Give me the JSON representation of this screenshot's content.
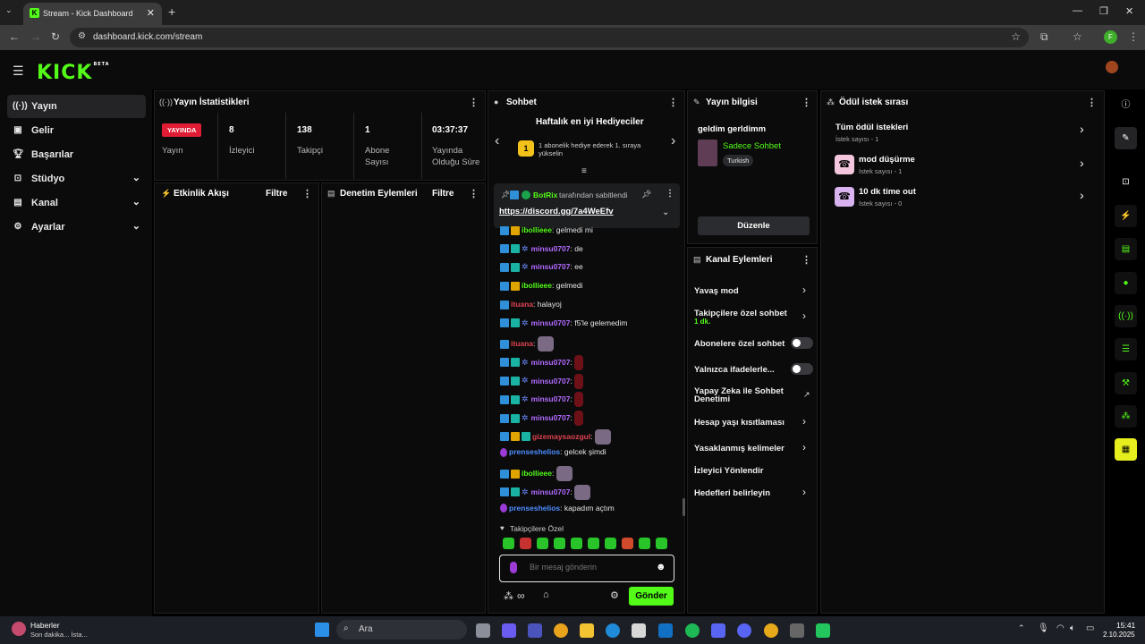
{
  "browser": {
    "tab_title": "Stream - Kick Dashboard",
    "favicon_letter": "K",
    "url": "dashboard.kick.com/stream",
    "profile_letter": "F"
  },
  "kick": {
    "logo": "KICK",
    "logo_badge": "BETA"
  },
  "sidebar": {
    "items": [
      {
        "label": "Yayın",
        "icon": "broadcast-icon"
      },
      {
        "label": "Gelir",
        "icon": "money-icon"
      },
      {
        "label": "Başarılar",
        "icon": "trophy-icon"
      },
      {
        "label": "Stüdyo",
        "icon": "studio-icon"
      },
      {
        "label": "Kanal",
        "icon": "channel-icon"
      },
      {
        "label": "Ayarlar",
        "icon": "gear-icon"
      }
    ]
  },
  "stats": {
    "title": "Yayın İstatistikleri",
    "live_badge": "YAYINDA",
    "live_label": "Yayın",
    "items": [
      {
        "value": "8",
        "label": "İzleyici"
      },
      {
        "value": "138",
        "label": "Takipçi"
      },
      {
        "value": "1",
        "label": "Abone Sayısı"
      },
      {
        "value": "03:37:37",
        "label": "Yayında Olduğu Süre"
      }
    ]
  },
  "activity": {
    "title": "Etkinlik Akışı",
    "filter": "Filtre"
  },
  "moderation": {
    "title": "Denetim Eylemleri",
    "filter": "Filtre"
  },
  "chat": {
    "title": "Sohbet",
    "gifters_title": "Haftalık en iyi Hediyeciler",
    "gifters_rank": "1",
    "gifters_text": "1 abonelik hediye ederek 1. sıraya yükselin",
    "pinned": {
      "user": "BotRix",
      "pinned_by": "tarafından sabitlendi",
      "link": "https://discord.gg/7a4WeEfv"
    },
    "messages": [
      {
        "user": "ibollieee",
        "color": "#53fc18",
        "text": "gelmedi mi",
        "badges": [
          "blue",
          "gold"
        ]
      },
      {
        "user": "minsu0707",
        "color": "#b26bff",
        "text": "de",
        "badges": [
          "blue",
          "teal",
          "gear"
        ]
      },
      {
        "user": "minsu0707",
        "color": "#b26bff",
        "text": "ee",
        "badges": [
          "blue",
          "teal",
          "gear"
        ]
      },
      {
        "user": "ibollieee",
        "color": "#53fc18",
        "text": "gelmedi",
        "badges": [
          "blue",
          "gold"
        ]
      },
      {
        "user": "ituana",
        "color": "#e0424f",
        "text": "halayoj",
        "badges": [
          "blue"
        ]
      },
      {
        "user": "minsu0707",
        "color": "#b26bff",
        "text": "f5'le gelemedim",
        "badges": [
          "blue",
          "teal",
          "gear"
        ]
      },
      {
        "user": "ituana",
        "color": "#e0424f",
        "text": "",
        "emote": "gray",
        "badges": [
          "blue"
        ]
      },
      {
        "user": "minsu0707",
        "color": "#b26bff",
        "text": "",
        "emote": "red",
        "badges": [
          "blue",
          "teal",
          "gear"
        ]
      },
      {
        "user": "minsu0707",
        "color": "#b26bff",
        "text": "",
        "emote": "red",
        "badges": [
          "blue",
          "teal",
          "gear"
        ]
      },
      {
        "user": "minsu0707",
        "color": "#b26bff",
        "text": "",
        "emote": "red",
        "badges": [
          "blue",
          "teal",
          "gear"
        ]
      },
      {
        "user": "minsu0707",
        "color": "#b26bff",
        "text": "",
        "emote": "red",
        "badges": [
          "blue",
          "teal",
          "gear"
        ]
      },
      {
        "user": "gizemaysaozgul",
        "color": "#e0424f",
        "text": "",
        "emote": "gray",
        "badges": [
          "blue",
          "gold",
          "teal"
        ]
      },
      {
        "user": "prenseshelios",
        "color": "#4d8dff",
        "text": "gelcek şimdi",
        "badges": [
          "mic"
        ]
      },
      {
        "user": "ibollieee",
        "color": "#53fc18",
        "text": "",
        "emote": "gray",
        "badges": [
          "blue",
          "gold"
        ]
      },
      {
        "user": "minsu0707",
        "color": "#b26bff",
        "text": "",
        "emote": "gray",
        "badges": [
          "blue",
          "teal",
          "gear"
        ]
      },
      {
        "user": "prenseshelios",
        "color": "#4d8dff",
        "text": "kapadım açtım",
        "badges": [
          "mic"
        ]
      }
    ],
    "followers_only_label": "Takipçilere Özel",
    "input_placeholder": "Bir mesaj gönderin",
    "send_label": "Gönder"
  },
  "stream_info": {
    "title": "Yayın bilgisi",
    "stream_title": "geldim gerldimm",
    "category": "Sadece Sohbet",
    "language": "Turkish",
    "edit_label": "Düzenle"
  },
  "channel_actions": {
    "title": "Kanal Eylemleri",
    "items": [
      {
        "label": "Yavaş mod",
        "type": "chevron"
      },
      {
        "label": "Takipçilere özel sohbet",
        "sub": "1 dk.",
        "type": "chevron"
      },
      {
        "label": "Abonelere özel sohbet",
        "type": "toggle"
      },
      {
        "label": "Yalnızca ifadelerle...",
        "type": "toggle"
      },
      {
        "label": "Yapay Zeka ile Sohbet Denetimi",
        "type": "external"
      },
      {
        "label": "Hesap yaşı kısıtlaması",
        "type": "chevron"
      },
      {
        "label": "Yasaklanmış kelimeler",
        "type": "chevron"
      },
      {
        "label": "İzleyici Yönlendir",
        "type": "none"
      },
      {
        "label": "Hedefleri belirleyin",
        "type": "chevron"
      }
    ]
  },
  "rewards": {
    "title": "Ödül istek sırası",
    "items": [
      {
        "label": "Tüm ödül istekleri",
        "sub": "İstek sayısı - 1"
      },
      {
        "label": "mod düşürme",
        "sub": "İstek sayısı - 1"
      },
      {
        "label": "10 dk time out",
        "sub": "İstek sayısı - 0"
      }
    ]
  },
  "taskbar": {
    "news_title": "Haberler",
    "news_sub": "Son dakika... İsta...",
    "search": "Ara",
    "time": "15:41",
    "date": "2.10.2025"
  }
}
